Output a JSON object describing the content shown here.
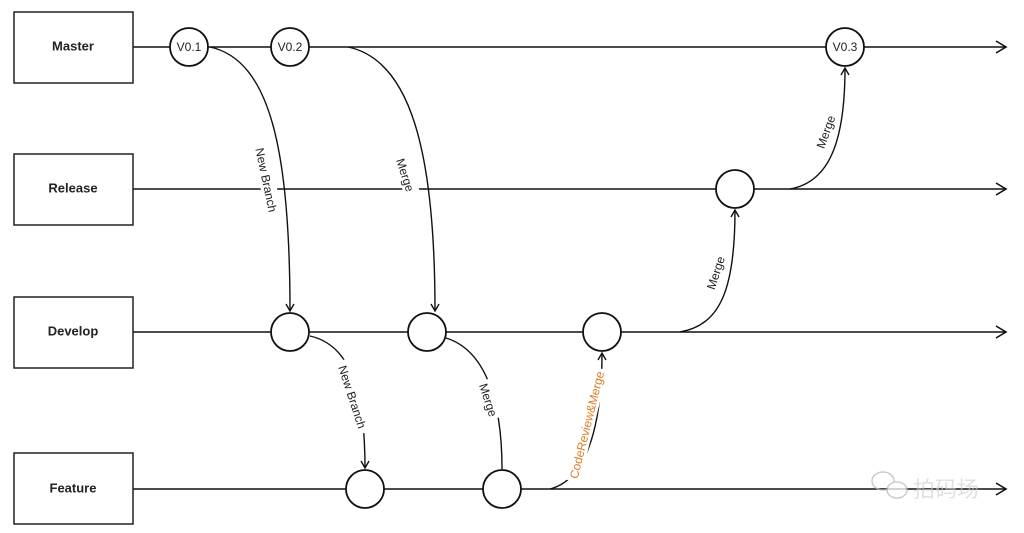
{
  "branches": [
    {
      "name": "Master"
    },
    {
      "name": "Release"
    },
    {
      "name": "Develop"
    },
    {
      "name": "Feature"
    }
  ],
  "tags": [
    "V0.1",
    "V0.2",
    "V0.3"
  ],
  "edges": [
    {
      "from": "Master V0.1",
      "to": "Develop",
      "label": "New Branch"
    },
    {
      "from": "Master V0.2",
      "to": "Develop",
      "label": "Merge"
    },
    {
      "from": "Develop",
      "to": "Feature",
      "label": "New Branch"
    },
    {
      "from": "Develop",
      "to": "Feature",
      "label": "Merge"
    },
    {
      "from": "Feature",
      "to": "Develop",
      "label": "CodeReview&Merge",
      "color": "#e07b22"
    },
    {
      "from": "Develop",
      "to": "Release",
      "label": "Merge"
    },
    {
      "from": "Release",
      "to": "Master V0.3",
      "label": "Merge"
    }
  ],
  "watermark": "拍码场",
  "colors": {
    "line": "#111111",
    "highlight": "#e07b22"
  }
}
